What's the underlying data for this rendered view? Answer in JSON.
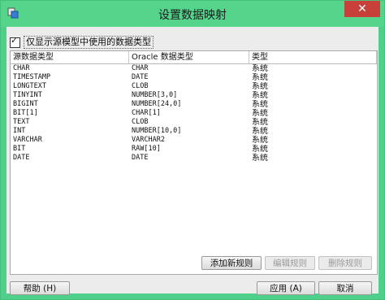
{
  "window": {
    "title": "设置数据映射",
    "close_glyph": "✕"
  },
  "checkbox": {
    "label": "仅显示源模型中使用的数据类型",
    "checked": true
  },
  "table": {
    "columns": [
      "源数据类型",
      "Oracle 数据类型",
      "类型"
    ],
    "rows": [
      [
        "CHAR",
        "CHAR",
        "系统"
      ],
      [
        "TIMESTAMP",
        "DATE",
        "系统"
      ],
      [
        "LONGTEXT",
        "CLOB",
        "系统"
      ],
      [
        "TINYINT",
        "NUMBER[3,0]",
        "系统"
      ],
      [
        "BIGINT",
        "NUMBER[24,0]",
        "系统"
      ],
      [
        "BIT[1]",
        "CHAR[1]",
        "系统"
      ],
      [
        "TEXT",
        "CLOB",
        "系统"
      ],
      [
        "INT",
        "NUMBER[10,0]",
        "系统"
      ],
      [
        "VARCHAR",
        "VARCHAR2",
        "系统"
      ],
      [
        "BIT",
        "RAW[10]",
        "系统"
      ],
      [
        "DATE",
        "DATE",
        "系统"
      ]
    ]
  },
  "buttons": {
    "add_rule": "添加新规则",
    "edit_rule": "编辑规则",
    "delete_rule": "删除规则",
    "help": "帮助 (H)",
    "apply": "应用 (A)",
    "cancel": "取消"
  },
  "colors": {
    "titlebar": "#55d48c",
    "close": "#c7403a",
    "client": "#ececec"
  }
}
